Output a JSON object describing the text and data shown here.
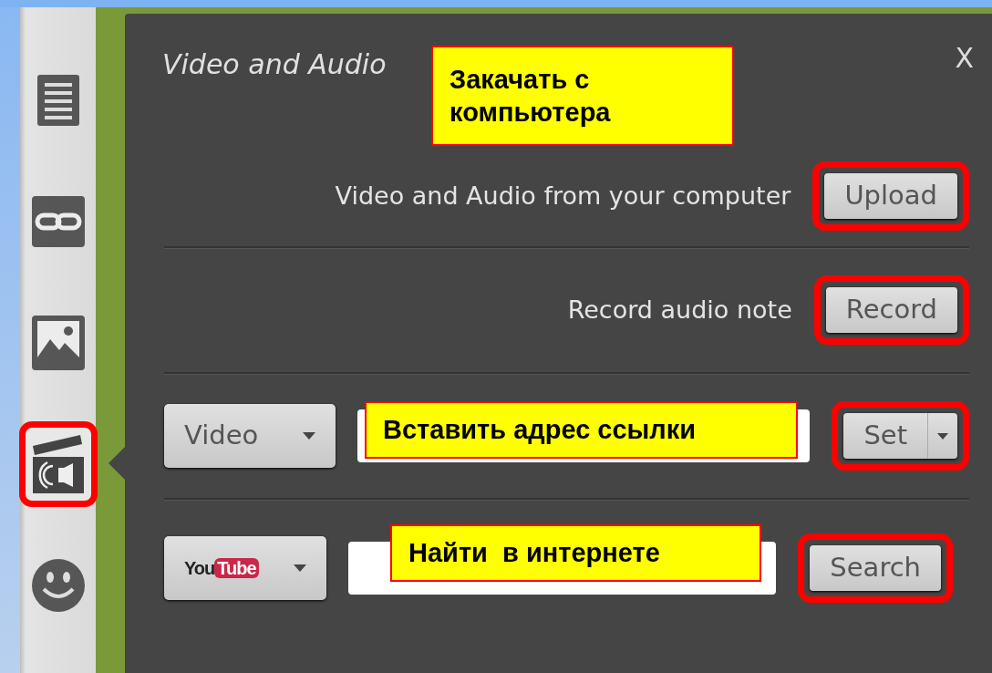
{
  "sidebar": {
    "items": [
      {
        "kind": "document",
        "selected": false,
        "highlighted": false
      },
      {
        "kind": "link",
        "selected": false,
        "highlighted": false
      },
      {
        "kind": "image",
        "selected": false,
        "highlighted": false
      },
      {
        "kind": "media",
        "selected": true,
        "highlighted": true
      },
      {
        "kind": "emoji",
        "selected": false,
        "highlighted": false
      }
    ]
  },
  "panel": {
    "title": "Video and Audio",
    "close": "X",
    "callout": "Закачать с компьютера"
  },
  "rows": [
    {
      "kind": "upload",
      "label": "Video and Audio from your computer",
      "button": {
        "label": "Upload",
        "split": false,
        "highlighted": true
      }
    },
    {
      "kind": "record",
      "label": "Record audio note",
      "button": {
        "label": "Record",
        "split": false,
        "highlighted": true
      }
    },
    {
      "kind": "link",
      "select": {
        "label": "Video"
      },
      "button": {
        "label": "Set",
        "split": true,
        "highlighted": true
      },
      "callout": "Вставить адрес ссылки"
    },
    {
      "kind": "search",
      "select": {
        "logo": [
          "You",
          "Tube"
        ]
      },
      "button": {
        "label": "Search",
        "split": false,
        "highlighted": true
      },
      "callout": "Найти  в интернете"
    }
  ]
}
